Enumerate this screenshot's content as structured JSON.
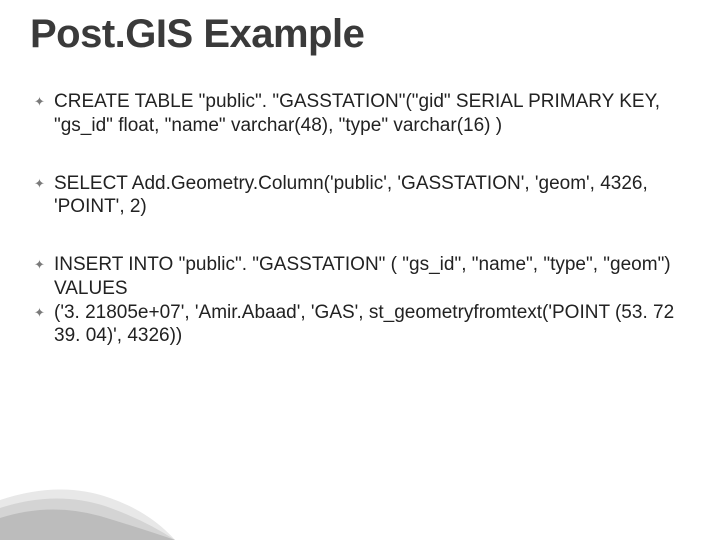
{
  "title": "Post.GIS Example",
  "bullets": [
    {
      "mark": "✦",
      "text": "CREATE TABLE \"public\". \"GASSTATION\"(\"gid\" SERIAL PRIMARY KEY, \"gs_id\" float, \"name\" varchar(48), \"type\" varchar(16) )"
    },
    {
      "mark": "✦",
      "text": "SELECT Add.Geometry.Column('public', 'GASSTATION', 'geom', 4326, 'POINT', 2)"
    },
    {
      "mark": "✦",
      "text": "INSERT INTO \"public\". \"GASSTATION\" ( \"gs_id\", \"name\", \"type\", \"geom\") VALUES"
    },
    {
      "mark": "✦",
      "text": "('3. 21805e+07', 'Amir.Abaad', 'GAS', st_geometryfromtext('POINT (53. 72 39. 04)', 4326))"
    }
  ]
}
